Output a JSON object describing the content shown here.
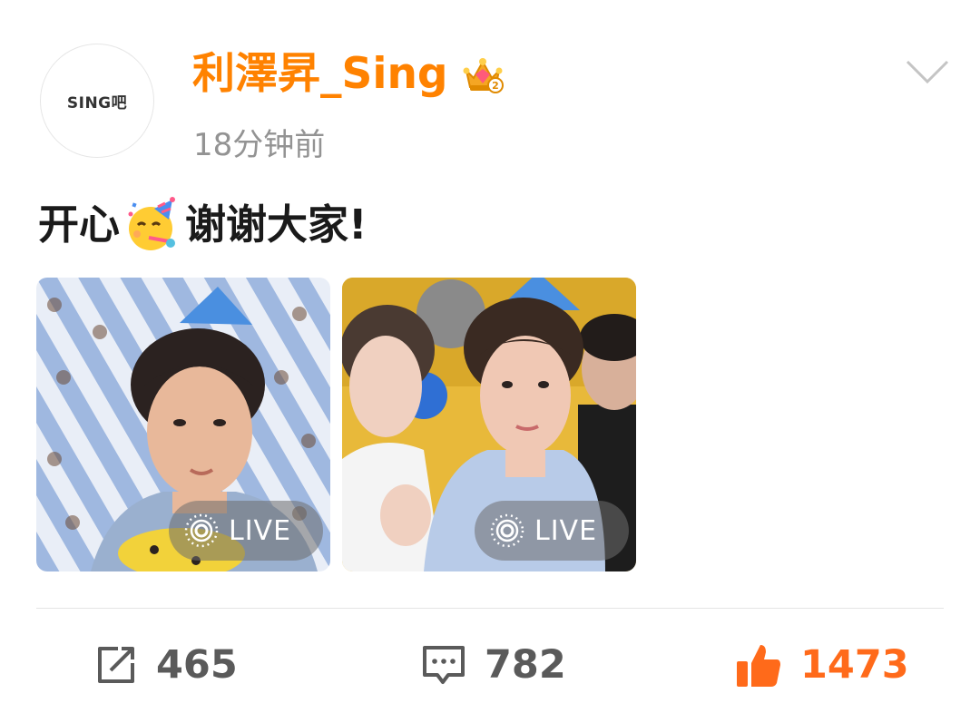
{
  "author": {
    "avatar_text": "SING吧",
    "name": "利澤昇_Sing",
    "badge_icon": "crown-badge-icon",
    "timestamp": "18分钟前"
  },
  "post": {
    "text_before": "开心",
    "emoji": "partying-face-emoji",
    "text_after": "谢谢大家!"
  },
  "photos": [
    {
      "live_label": "LIVE",
      "subject": "birthday-selfie"
    },
    {
      "live_label": "LIVE",
      "subject": "group-selfie"
    }
  ],
  "actions": {
    "repost_count": "465",
    "comment_count": "782",
    "like_count": "1473"
  },
  "colors": {
    "accent": "#ff8200",
    "like": "#ff6a1a",
    "muted": "#939393",
    "action_gray": "#5a5a5a"
  }
}
